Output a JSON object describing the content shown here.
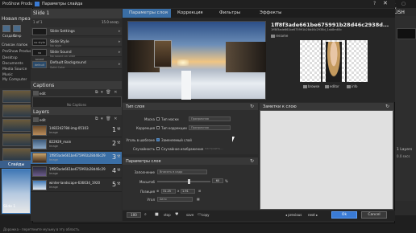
{
  "background_app": {
    "app_name": "ProShow Producer",
    "project_title": "Новая презен",
    "publish_label": "UBLISH",
    "window_controls": "– ▢ ✕",
    "ribbon": {
      "item1": "Создать",
      "item2": "Откр"
    },
    "file_list_title": "Список папок",
    "folders": [
      "ProShow Produce",
      "Desktop",
      "Documents",
      "Media Source",
      "Music",
      "My Computer"
    ],
    "slides_tab": "Слайды",
    "slide1_label": "Slide 1",
    "right_layers": "1 Layers",
    "right_note": "0.0 secs",
    "bottom_text": "Дорожка - перетяните музыку в эту область"
  },
  "dialog": {
    "title": "Параметры слайда",
    "help": "?",
    "close": "✕"
  },
  "slide_panel": {
    "title": "Slide 1",
    "count": "1 of 1",
    "duration": "15.0 secs",
    "settings": [
      {
        "badge": "",
        "title": "Slide Settings",
        "sub": ""
      },
      {
        "badge": "no style",
        "title": "Slide Style",
        "sub": "No style"
      },
      {
        "badge": "no sound",
        "title": "Slide Sound",
        "sub": "No sound on slide"
      },
      {
        "badge": "default",
        "title": "Default Background",
        "sub": "Solid Color"
      }
    ],
    "arrow": "▸"
  },
  "captions": {
    "title": "Captions",
    "add": "+",
    "edit": "edit",
    "tools": "⧉ ▾ 🗑 ✕",
    "empty": "No Captions"
  },
  "layers": {
    "title": "Layers",
    "add": "+",
    "edit": "edit",
    "tools": "⧉ ▾ 🗑 ✕",
    "items": [
      {
        "name": "1482242784-img-05103",
        "type": "Image",
        "num": "1",
        "tool": "⚒"
      },
      {
        "name": "822929_main",
        "type": "Image",
        "num": "2",
        "tool": "⚒"
      },
      {
        "name": "1ff8f3ade661be675991b28d46c29",
        "type": "Image",
        "num": "3",
        "tool": "⚒"
      },
      {
        "name": "1ff8f3ade661be675991b28d46c29",
        "type": "Image",
        "num": "4",
        "tool": "⚒"
      },
      {
        "name": "winter-landscape-636634_1920",
        "type": "Image",
        "num": "5",
        "tool": "⚒"
      }
    ]
  },
  "tabs": [
    "Параметры слоя",
    "Коррекция",
    "Фильтры",
    "Эффекты"
  ],
  "layer_info": {
    "title": "1ff8f3ade661be675991b28d46c2938d...",
    "subtitle": "1ff8f3ade661be675991b28d46c2938d_1ab8m60c",
    "rename": "rename",
    "browse": "browse",
    "editor": "editor",
    "info": "info"
  },
  "layer_type": {
    "title": "Тип слоя",
    "refresh": "↻",
    "mask_label": "Маска",
    "mask_check": "Тип маски",
    "mask_select": "Прозрачная",
    "corr_label": "Коррекция",
    "corr_check": "Тип коррекции",
    "corr_select": "Прозрачная",
    "tpl_label": "Уголь в шаблоне",
    "tpl_check": "Заменяемый слой",
    "rand_label": "Случайность",
    "rand_check": "Случайное изображение",
    "rand_dim": "настроить…"
  },
  "layer_params": {
    "title": "Параметры слоя",
    "refresh": "↻",
    "fill_label": "Заполнение",
    "fill_value": "Вписать в кадр",
    "scale_label": "Масштаб",
    "scale_value": "60",
    "scale_unit": "%",
    "scale_level": 0.6,
    "pos_label": "Позиция",
    "pos_x": "31.25",
    "pos_y": "1.91",
    "angle_label": "Угол",
    "angle_value": "Авто"
  },
  "notes": {
    "title": "Заметки к слою",
    "refresh": "↻"
  },
  "bottom_bar": {
    "zoom": "100",
    "stop": "stop",
    "save": "save",
    "copy": "copy",
    "previous": "◂ previous",
    "next": "next ▸",
    "ok": "Ok",
    "cancel": "Cancel"
  },
  "colors": {
    "accent": "#3a6ea5",
    "ok_button": "#3a7bd5",
    "dialog_bg": "#2a2a2a"
  }
}
